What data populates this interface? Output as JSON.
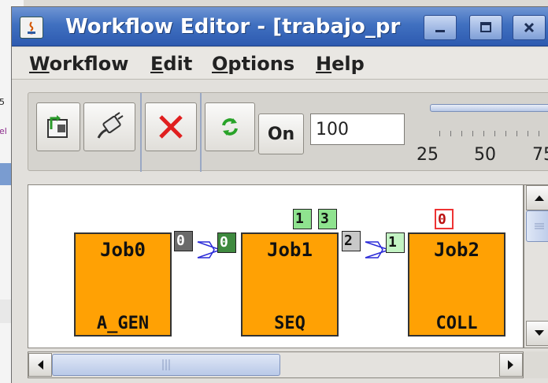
{
  "background_window": {
    "fragments": [
      "5",
      "el"
    ]
  },
  "window": {
    "title": "Workflow Editor - [trabajo_pr"
  },
  "title_buttons": {
    "minimize": "minimize-icon",
    "maximize": "maximize-icon",
    "close": "close-icon"
  },
  "menu": [
    {
      "mnemonic": "W",
      "rest": "orkflow"
    },
    {
      "mnemonic": "E",
      "rest": "dit"
    },
    {
      "mnemonic": "O",
      "rest": "ptions"
    },
    {
      "mnemonic": "H",
      "rest": "elp"
    }
  ],
  "toolbar": {
    "icons": [
      "open-workflow-icon",
      "plug-icon",
      "delete-icon",
      "refresh-icon"
    ],
    "on_label": "On",
    "speed_value": "100",
    "slider_labels": [
      "25",
      "50",
      "75"
    ]
  },
  "canvas": {
    "jobs": [
      {
        "name": "Job0",
        "type": "A_GEN"
      },
      {
        "name": "Job1",
        "type": "SEQ"
      },
      {
        "name": "Job2",
        "type": "COLL"
      }
    ],
    "ports": [
      "0",
      "0",
      "1",
      "3",
      "2",
      "1",
      "0"
    ]
  },
  "colors": {
    "job_fill": "#ffa104",
    "titlebar": "#4070c0",
    "port_red": "#ee3333"
  }
}
